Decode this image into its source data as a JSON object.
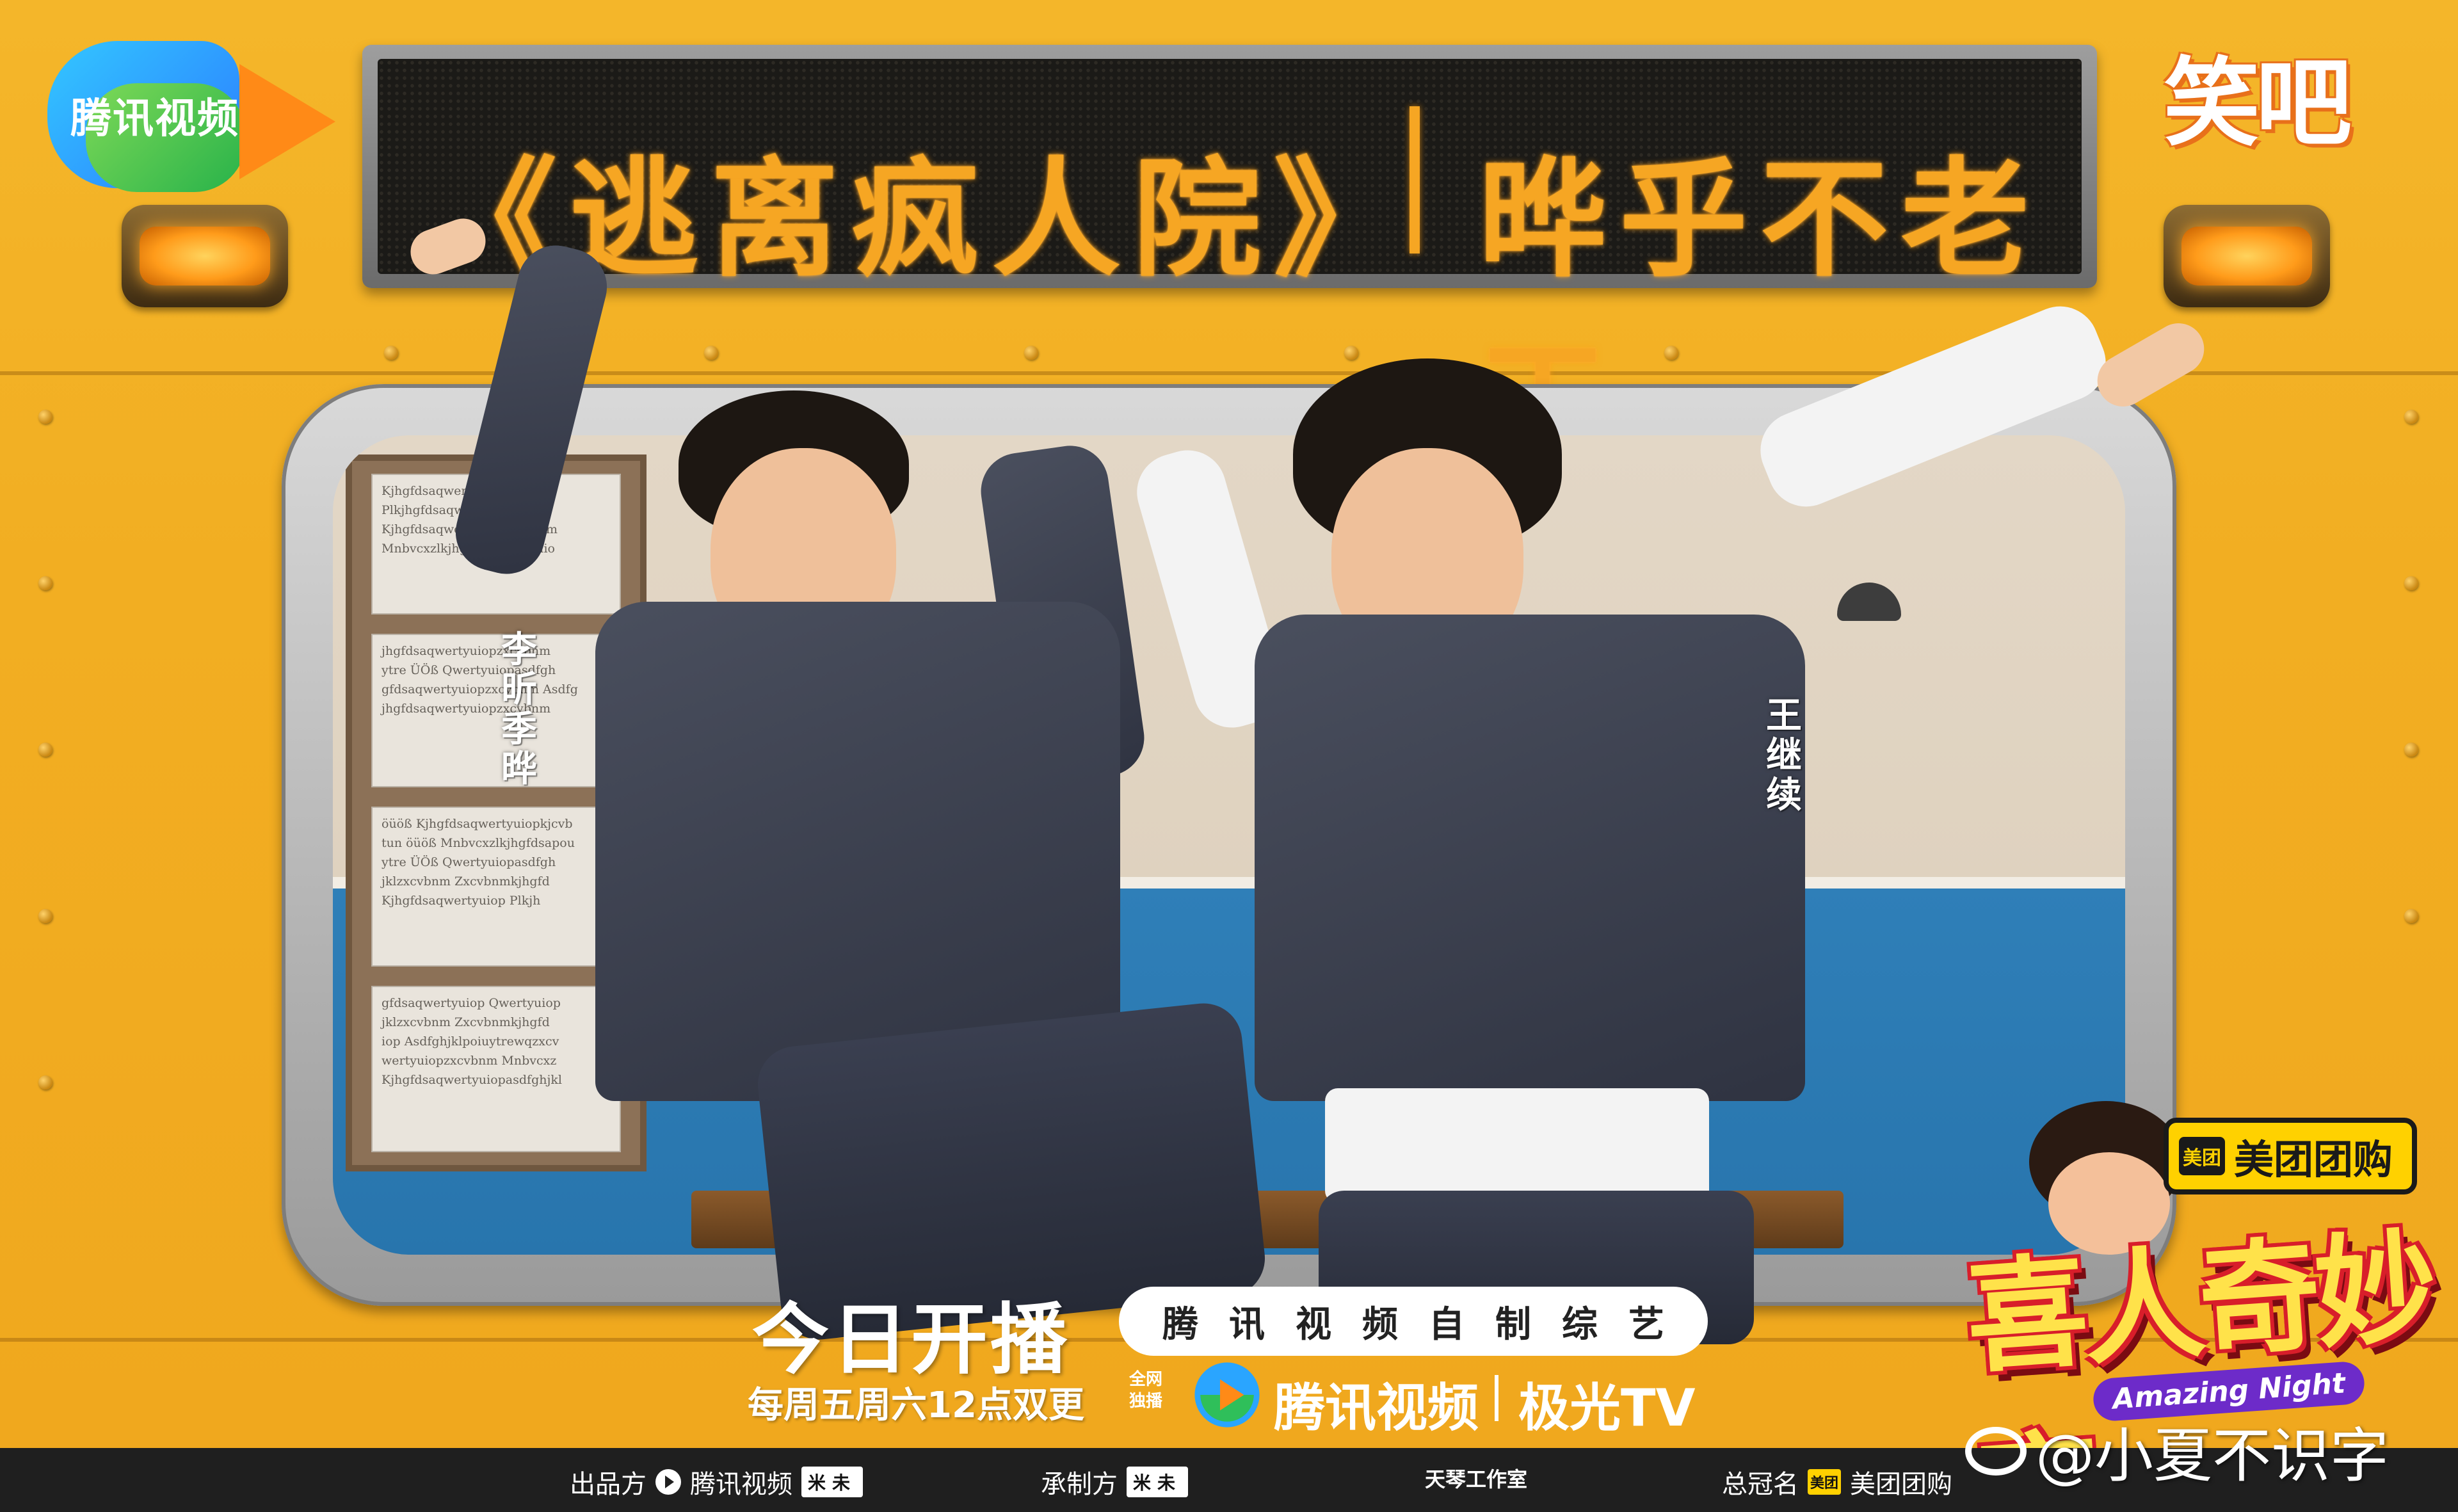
{
  "sign": {
    "title": "《逃离疯人院》",
    "subtitle": "晔乎不老王"
  },
  "logos": {
    "tencent": "腾讯视频",
    "xiaoba": "笑吧"
  },
  "cast": {
    "left": "李昕季晔",
    "right": "王继续"
  },
  "notice_text": [
    "Kjhgfdsaqwertyuiopkjhgfd",
    "Plkjhgfdsaqwertyuiopkjhgf",
    "Kjhgfdsaqwertyuiopkjcvbnm",
    "Mnbvcxzlkjhgfdsaqwertyuio",
    "jhgfdsaqwertyuiopzxcvbnm",
    "ytre ÜÖß Qwertyuiopasdfgh",
    "gfdsaqwertyuiopzxcvbnm Asdfg",
    "jhgfdsaqwertyuiopzxcvbnm",
    "öüöß Kjhgfdsaqwertyuiopkjcvb",
    "tun öüöß Mnbvcxzlkjhgfdsapou",
    "ytre ÜÖß Qwertyuiopasdfgh",
    "jklzxcvbnm Zxcvbnmkjhgfd",
    "Kjhgfdsaqwertyuiop Plkjh",
    "gfdsaqwertyuiop Qwertyuiop",
    "jklzxcvbnm Zxcvbnmkjhgfd",
    "iop Asdfghjklpoiuytrewqzxcv",
    "wertyuiopzxcvbnm Mnbvcxz",
    "Kjhgfdsaqwertyuiopasdfghjkl"
  ],
  "meituan": {
    "icon_text": "美团",
    "label": "美团团购"
  },
  "show": {
    "title": "喜人奇妙夜",
    "subtitle": "Amazing Night"
  },
  "broadcast": {
    "today": "今日开播",
    "schedule": "每周五周六12点双更",
    "self_made": "腾讯视频自制综艺",
    "exclusive": "全网独播",
    "platform_tencent": "腾讯视频",
    "platform_tv": "极光TV"
  },
  "credits": {
    "producer_label": "出品方",
    "producer_name": "腾讯视频",
    "producer_chip": "米未",
    "maker_label": "承制方",
    "maker_chip": "米未",
    "studio": "天琴工作室",
    "sponsor_label": "总冠名",
    "sponsor_icon": "美团",
    "sponsor_name": "美团团购"
  },
  "watermark": "@小夏不识字",
  "colors": {
    "body": "#f2ae22",
    "led": "#f6a623",
    "meituan": "#ffd100",
    "title_outline": "#d81e2a"
  }
}
